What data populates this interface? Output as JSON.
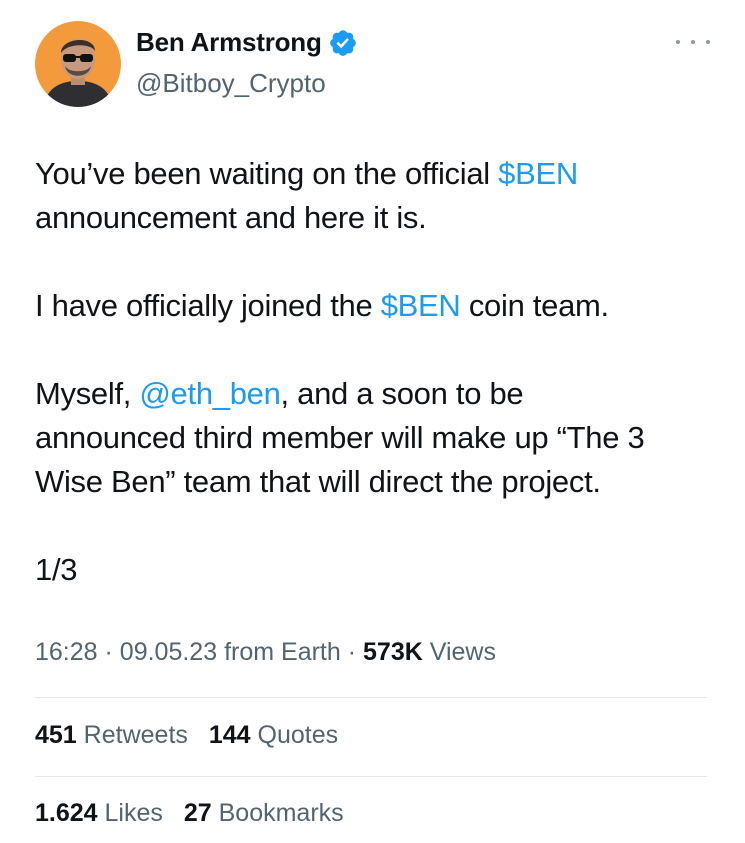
{
  "author": {
    "name": "Ben Armstrong",
    "handle": "@Bitboy_Crypto",
    "verified_icon": "verified-badge-icon",
    "avatar_bg": "#f39a3c"
  },
  "tweet": {
    "p1_before": "You’ve been waiting on the official ",
    "p1_link": "$BEN",
    "p1_line2": "announcement and here it is.",
    "p2_before": "I have officially joined the ",
    "p2_link": "$BEN",
    "p2_after": " coin team.",
    "p3_before": "Myself, ",
    "p3_mention": "@eth_ben",
    "p3_after": ", and a soon to be",
    "p3_line2": "announced third member will make up “The 3",
    "p3_line3": "Wise Ben” team that will direct the project.",
    "p4": "1/3"
  },
  "meta": {
    "time": "16:28",
    "date": "09.05.23",
    "source": "from Earth",
    "views_count": "573K",
    "views_label": "Views",
    "separator": "·"
  },
  "stats": {
    "retweets_count": "451",
    "retweets_label": "Retweets",
    "quotes_count": "144",
    "quotes_label": "Quotes",
    "likes_count": "1.624",
    "likes_label": "Likes",
    "bookmarks_count": "27",
    "bookmarks_label": "Bookmarks"
  },
  "colors": {
    "link": "#1d9bf0",
    "secondary_text": "#536471",
    "primary_text": "#0f1419",
    "verified": "#1d9bf0"
  }
}
